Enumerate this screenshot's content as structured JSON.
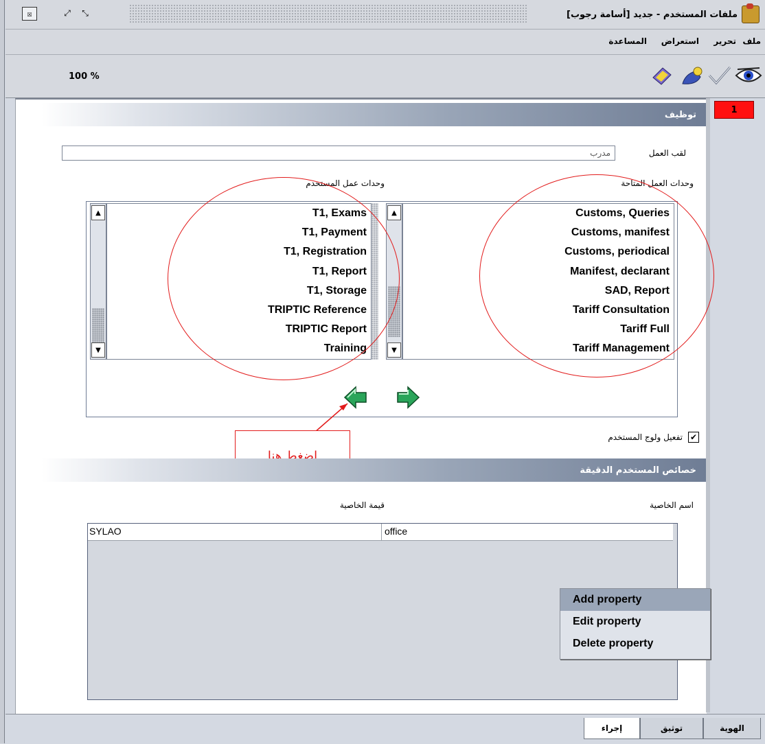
{
  "window": {
    "title": "ملفات المستخدم - جديد [أسامة رجوب]"
  },
  "menu": {
    "items": [
      "ملف",
      "تحرير",
      "استعراض",
      "المساعدة"
    ]
  },
  "toolbar": {
    "zoom": "100 %",
    "icons": [
      "eye-icon",
      "check-icon",
      "key-icon",
      "book-icon"
    ]
  },
  "page_badge": "1",
  "job": {
    "section_title": "توظيف",
    "title_label": "لقب العمل",
    "title_value": "مدرب"
  },
  "units": {
    "available_label": "وحدات العمل المتاحة",
    "user_label": "وحدات عمل المستخدم",
    "available": [
      "Customs, Queries",
      "Customs, manifest",
      "Customs, periodical",
      "Manifest, declarant",
      "SAD, Report",
      "Tariff Consultation",
      "Tariff Full",
      "Tariff Management"
    ],
    "user": [
      "T1, Exams",
      "T1, Payment",
      "T1, Registration",
      "T1, Report",
      "T1, Storage",
      "TRIPTIC Reference",
      "TRIPTIC Report",
      "Training"
    ]
  },
  "login": {
    "label": "تفعيل ولوج المستخدم",
    "checked": "✔"
  },
  "callout": {
    "text": "اضغط هنا"
  },
  "properties": {
    "section_title": "خصائص المستخدم الدقيقة",
    "name_label": "اسم الخاصية",
    "value_label": "قيمة الخاصية",
    "rows": [
      {
        "name": "office",
        "value": "SYLAO"
      }
    ]
  },
  "context_menu": {
    "items": [
      "Add property",
      "Edit property",
      "Delete property"
    ]
  },
  "tabs": [
    "الهوية",
    "توثيق",
    "إجراء"
  ],
  "colors": {
    "accent_red": "#e21b1b",
    "badge_red": "#ff1010",
    "section_header": "#6f7d95"
  }
}
